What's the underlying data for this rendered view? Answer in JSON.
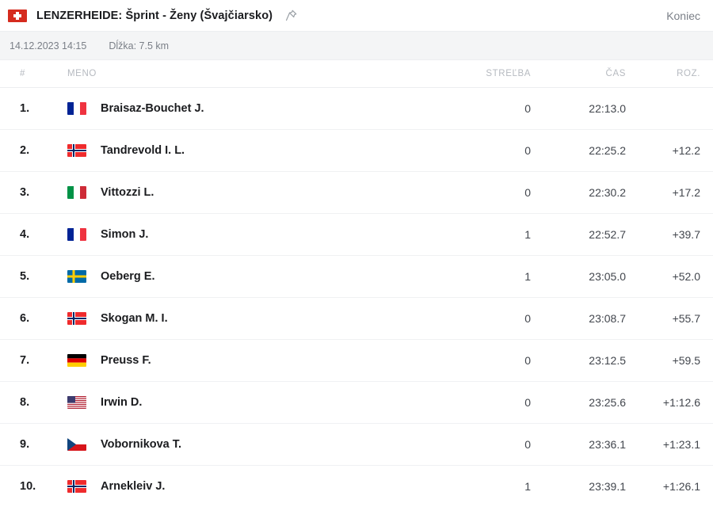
{
  "header": {
    "country_flag": "switzerland-flag-icon",
    "title": "LENZERHEIDE: Šprint - Ženy (Švajčiarsko)",
    "pin_icon": "pin-icon",
    "status": "Koniec"
  },
  "subheader": {
    "datetime": "14.12.2023 14:15",
    "length": "Dĺžka: 7.5 km"
  },
  "table": {
    "columns": {
      "rank": "#",
      "name": "MENO",
      "shooting": "STREĽBA",
      "time": "ČAS",
      "diff": "ROZ."
    },
    "rows": [
      {
        "rank": "1.",
        "flag": "france-flag-icon",
        "name": "Braisaz-Bouchet J.",
        "shooting": "0",
        "time": "22:13.0",
        "diff": ""
      },
      {
        "rank": "2.",
        "flag": "norway-flag-icon",
        "name": "Tandrevold I. L.",
        "shooting": "0",
        "time": "22:25.2",
        "diff": "+12.2"
      },
      {
        "rank": "3.",
        "flag": "italy-flag-icon",
        "name": "Vittozzi L.",
        "shooting": "0",
        "time": "22:30.2",
        "diff": "+17.2"
      },
      {
        "rank": "4.",
        "flag": "france-flag-icon",
        "name": "Simon J.",
        "shooting": "1",
        "time": "22:52.7",
        "diff": "+39.7"
      },
      {
        "rank": "5.",
        "flag": "sweden-flag-icon",
        "name": "Oeberg E.",
        "shooting": "1",
        "time": "23:05.0",
        "diff": "+52.0"
      },
      {
        "rank": "6.",
        "flag": "norway-flag-icon",
        "name": "Skogan M. I.",
        "shooting": "0",
        "time": "23:08.7",
        "diff": "+55.7"
      },
      {
        "rank": "7.",
        "flag": "germany-flag-icon",
        "name": "Preuss F.",
        "shooting": "0",
        "time": "23:12.5",
        "diff": "+59.5"
      },
      {
        "rank": "8.",
        "flag": "usa-flag-icon",
        "name": "Irwin D.",
        "shooting": "0",
        "time": "23:25.6",
        "diff": "+1:12.6"
      },
      {
        "rank": "9.",
        "flag": "czech-republic-flag-icon",
        "name": "Vobornikova T.",
        "shooting": "0",
        "time": "23:36.1",
        "diff": "+1:23.1"
      },
      {
        "rank": "10.",
        "flag": "norway-flag-icon",
        "name": "Arnekleiv J.",
        "shooting": "1",
        "time": "23:39.1",
        "diff": "+1:26.1"
      }
    ]
  },
  "colors": {
    "text_primary": "#1b1c1f",
    "text_secondary": "#42464d",
    "text_muted": "#7a7f87",
    "header_muted": "#b6bac0",
    "divider": "#f0f1f3",
    "subheader_bg": "#f4f5f6",
    "flag_red": "#ef3340",
    "flag_blue": "#002395",
    "flag_green": "#009246",
    "flag_yellow": "#fecb00"
  }
}
